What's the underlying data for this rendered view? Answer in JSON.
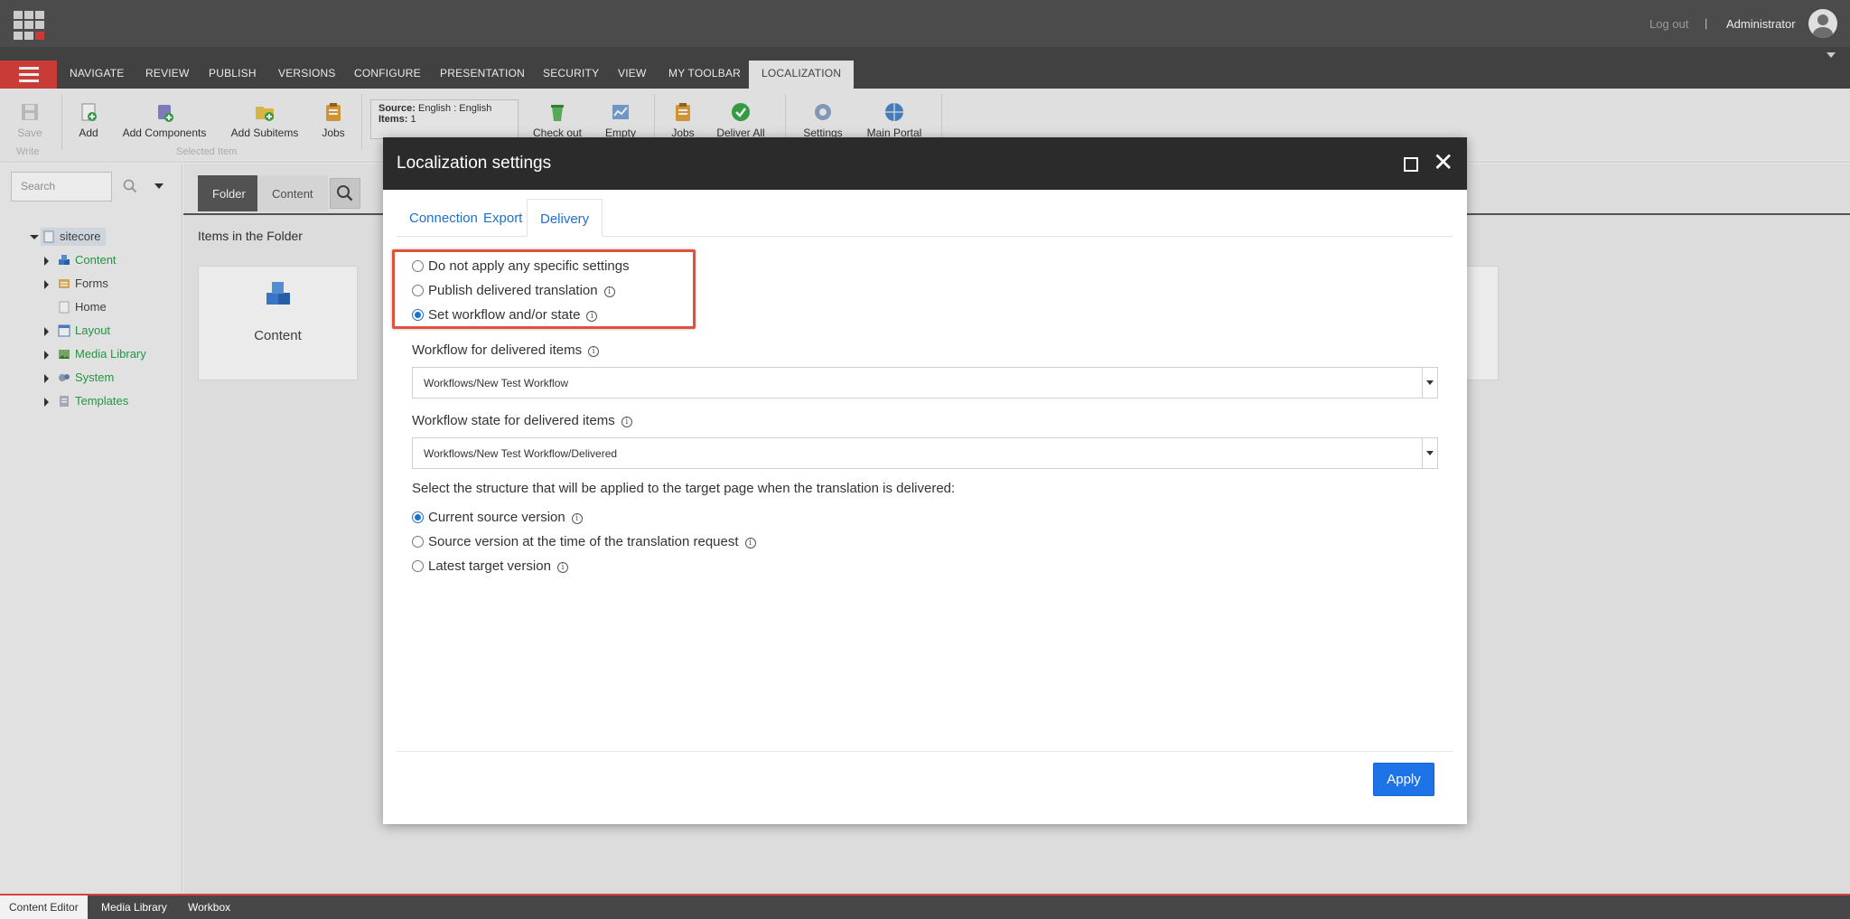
{
  "header": {
    "logout": "Log out",
    "separator": "|",
    "user": "Administrator"
  },
  "ribbon": {
    "tabs": [
      "NAVIGATE",
      "REVIEW",
      "PUBLISH",
      "VERSIONS",
      "CONFIGURE",
      "PRESENTATION",
      "SECURITY",
      "VIEW",
      "MY TOOLBAR",
      "LOCALIZATION"
    ],
    "active_tab": "LOCALIZATION",
    "tools": {
      "save": "Save",
      "write_group": "Write",
      "add": "Add",
      "add_components": "Add Components",
      "add_subitems": "Add Subitems",
      "jobs": "Jobs",
      "selected_item_group": "Selected Item",
      "source_label": "Source:",
      "source_value": "English : English",
      "items_label": "Items:",
      "items_value": "1",
      "check_out": "Check out",
      "empty": "Empty",
      "jobs2": "Jobs",
      "deliver_all": "Deliver All",
      "settings": "Settings",
      "main_portal": "Main Portal"
    }
  },
  "sidebar": {
    "search_placeholder": "Search",
    "tree": [
      {
        "label": "sitecore",
        "icon": "document-icon"
      },
      {
        "label": "Content",
        "icon": "cubes-icon"
      },
      {
        "label": "Forms",
        "icon": "forms-icon"
      },
      {
        "label": "Home",
        "icon": "page-icon"
      },
      {
        "label": "Layout",
        "icon": "layout-icon"
      },
      {
        "label": "Media Library",
        "icon": "image-icon"
      },
      {
        "label": "System",
        "icon": "system-icon"
      },
      {
        "label": "Templates",
        "icon": "template-icon"
      }
    ]
  },
  "content": {
    "tabs": [
      "Folder",
      "Content"
    ],
    "items_title": "Items in the Folder",
    "card_label": "Content"
  },
  "bottom_tabs": [
    "Content Editor",
    "Media Library",
    "Workbox"
  ],
  "dialog": {
    "title": "Localization settings",
    "tabs": [
      "Connection",
      "Export",
      "Delivery"
    ],
    "active_tab": "Delivery",
    "delivery_options": [
      {
        "label": "Do not apply any specific settings",
        "checked": false,
        "info": false
      },
      {
        "label": "Publish delivered translation",
        "checked": false,
        "info": true
      },
      {
        "label": "Set workflow and/or state",
        "checked": true,
        "info": true
      }
    ],
    "workflow_label": "Workflow for delivered items",
    "workflow_value": "Workflows/New Test Workflow",
    "workflow_state_label": "Workflow state for delivered items",
    "workflow_state_value": "Workflows/New Test Workflow/Delivered",
    "structure_label": "Select the structure that will be applied to the target page when the translation is delivered:",
    "structure_options": [
      {
        "label": "Current source version",
        "checked": true
      },
      {
        "label": "Source version at the time of the translation request",
        "checked": false
      },
      {
        "label": "Latest target version",
        "checked": false
      }
    ],
    "apply": "Apply"
  },
  "colors": {
    "accent_red": "#d9413b",
    "link_blue": "#1f6fcf",
    "apply_blue": "#1f73e8",
    "highlight": "#e0523c",
    "tree_green": "#26a24a"
  }
}
